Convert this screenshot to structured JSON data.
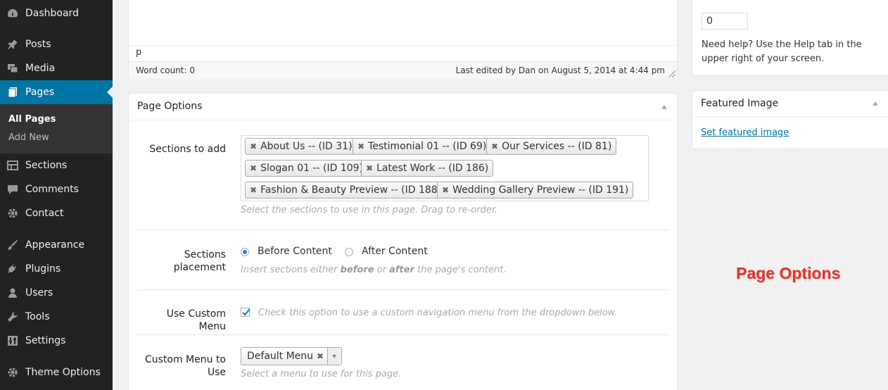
{
  "sidebar": {
    "items": [
      {
        "label": "Dashboard",
        "icon": "dashboard-icon"
      },
      {
        "label": "Posts",
        "icon": "pin-icon"
      },
      {
        "label": "Media",
        "icon": "media-icon"
      },
      {
        "label": "Pages",
        "icon": "pages-icon",
        "current": true
      },
      {
        "label": "Sections",
        "icon": "sections-icon"
      },
      {
        "label": "Comments",
        "icon": "comment-icon"
      },
      {
        "label": "Contact",
        "icon": "gear-icon"
      },
      {
        "label": "Appearance",
        "icon": "paintbrush-icon"
      },
      {
        "label": "Plugins",
        "icon": "plug-icon"
      },
      {
        "label": "Users",
        "icon": "user-icon"
      },
      {
        "label": "Tools",
        "icon": "wrench-icon"
      },
      {
        "label": "Settings",
        "icon": "settings-icon"
      },
      {
        "label": "Theme Options",
        "icon": "gear-icon"
      }
    ],
    "submenu": [
      {
        "label": "All Pages",
        "current": true
      },
      {
        "label": "Add New"
      }
    ]
  },
  "editor": {
    "path": "p",
    "word_count": "Word count: 0",
    "last_edited": "Last edited by Dan on August 5, 2014 at 4:44 pm"
  },
  "page_options": {
    "title": "Page Options",
    "sections_to_add": {
      "label": "Sections to add",
      "tokens": [
        "About Us -- (ID 31)",
        "Testimonial 01 -- (ID 69)",
        "Our Services -- (ID 81)",
        "Slogan 01 -- (ID 109)",
        "Latest Work -- (ID 186)",
        "Fashion & Beauty Preview -- (ID 188)",
        "Wedding Gallery Preview -- (ID 191)"
      ],
      "hint": "Select the sections to use in this page. Drag to re-order."
    },
    "placement": {
      "label_line1": "Sections",
      "label_line2": "placement",
      "option_before": "Before Content",
      "option_after": "After Content",
      "selected": "Before Content",
      "hint_part1": "Insert sections either ",
      "hint_bold1": "before",
      "hint_part2": " or ",
      "hint_bold2": "after",
      "hint_part3": " the page's content."
    },
    "custom_menu": {
      "label": "Use Custom Menu",
      "checked": true,
      "hint": "Check this option to use a custom navigation menu from the dropdown below."
    },
    "menu_select": {
      "label_line1": "Custom Menu to",
      "label_line2": "Use",
      "value": "Default Menu",
      "hint": "Select a menu to use for this page."
    }
  },
  "publish": {
    "order_value": "0",
    "help": "Need help? Use the Help tab in the upper right of your screen."
  },
  "featured_image": {
    "title": "Featured Image",
    "link": "Set featured image"
  },
  "annotation": "Page Options",
  "colors": {
    "sidebar_bg": "#222222",
    "current_menu": "#0074a2",
    "annotation_red": "#e8332a",
    "link_blue": "#0074a2"
  }
}
